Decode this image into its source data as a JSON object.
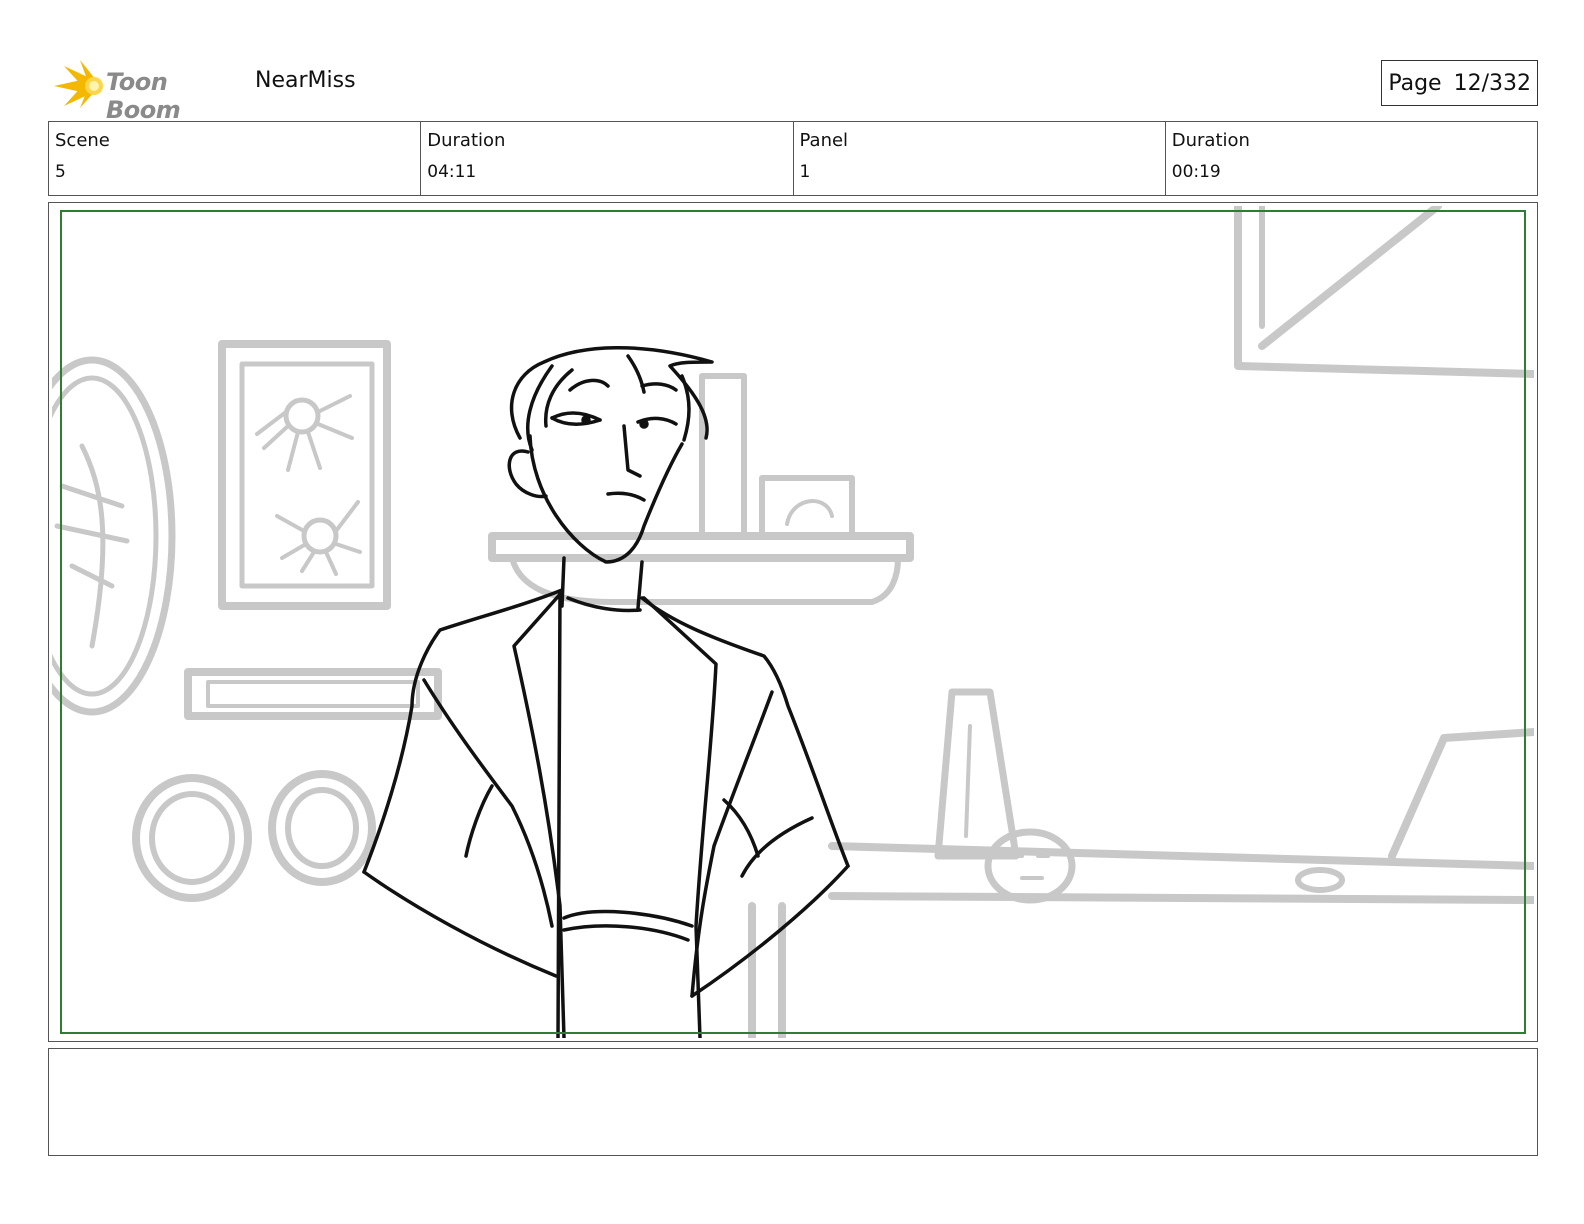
{
  "header": {
    "brand": "Toon Boom",
    "project": "NearMiss",
    "page_label": "Page",
    "page_value": "12/332"
  },
  "info": {
    "scene_label": "Scene",
    "scene_value": "5",
    "scene_duration_label": "Duration",
    "scene_duration_value": "04:11",
    "panel_label": "Panel",
    "panel_value": "1",
    "panel_duration_label": "Duration",
    "panel_duration_value": "00:19"
  },
  "colors": {
    "safe_frame": "#2e7d32",
    "background_sketch": "#c8c8c8",
    "character_line": "#111111",
    "logo_accent": "#f5b800"
  },
  "notes": {
    "text": ""
  }
}
